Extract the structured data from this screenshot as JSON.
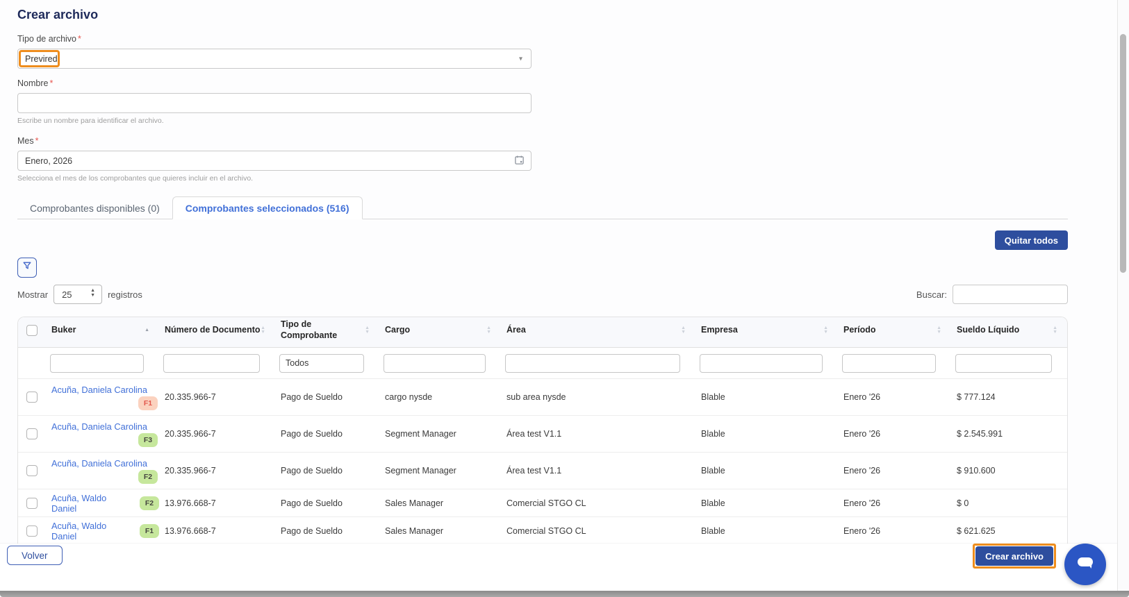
{
  "page": {
    "title": "Crear archivo"
  },
  "form": {
    "tipo": {
      "label": "Tipo de archivo",
      "required_mark": "*",
      "value": "Previred"
    },
    "nombre": {
      "label": "Nombre",
      "required_mark": "*",
      "value": "",
      "helper": "Escribe un nombre para identificar el archivo."
    },
    "mes": {
      "label": "Mes",
      "required_mark": "*",
      "value": "Enero, 2026",
      "helper": "Selecciona el mes de los comprobantes que quieres incluir en el archivo."
    }
  },
  "tabs": [
    {
      "label": "Comprobantes disponibles (0)",
      "active": false
    },
    {
      "label": "Comprobantes seleccionados (516)",
      "active": true
    }
  ],
  "toolbar": {
    "remove_all_label": "Quitar todos",
    "show_label": "Mostrar",
    "page_size": "25",
    "records_label": "registros",
    "search_label": "Buscar:"
  },
  "table": {
    "sort": {
      "column": "Buker",
      "direction": "asc"
    },
    "columns": [
      {
        "label": "Buker"
      },
      {
        "label": "Número de Documento"
      },
      {
        "label": "Tipo de Comprobante"
      },
      {
        "label": "Cargo"
      },
      {
        "label": "Área"
      },
      {
        "label": "Empresa"
      },
      {
        "label": "Período"
      },
      {
        "label": "Sueldo Líquido"
      }
    ],
    "filter_row": {
      "tipo_value": "Todos"
    },
    "rows": [
      {
        "name": "Acuña, Daniela Carolina",
        "badge": "F1",
        "badge_style": "salmon",
        "doc": "20.335.966-7",
        "tipo": "Pago de Sueldo",
        "cargo": "cargo nysde",
        "area": "sub area nysde",
        "empresa": "Blable",
        "periodo": "Enero '26",
        "sueldo": "$ 777.124"
      },
      {
        "name": "Acuña, Daniela Carolina",
        "badge": "F3",
        "badge_style": "green",
        "doc": "20.335.966-7",
        "tipo": "Pago de Sueldo",
        "cargo": "Segment Manager",
        "area": "Área test V1.1",
        "empresa": "Blable",
        "periodo": "Enero '26",
        "sueldo": "$ 2.545.991"
      },
      {
        "name": "Acuña, Daniela Carolina",
        "badge": "F2",
        "badge_style": "green",
        "doc": "20.335.966-7",
        "tipo": "Pago de Sueldo",
        "cargo": "Segment Manager",
        "area": "Área test V1.1",
        "empresa": "Blable",
        "periodo": "Enero '26",
        "sueldo": "$ 910.600"
      },
      {
        "name": "Acuña, Waldo Daniel",
        "badge": "F2",
        "badge_style": "green",
        "doc": "13.976.668-7",
        "tipo": "Pago de Sueldo",
        "cargo": "Sales Manager",
        "area": "Comercial STGO CL",
        "empresa": "Blable",
        "periodo": "Enero '26",
        "sueldo": "$ 0"
      },
      {
        "name": "Acuña, Waldo Daniel",
        "badge": "F1",
        "badge_style": "green",
        "doc": "13.976.668-7",
        "tipo": "Pago de Sueldo",
        "cargo": "Sales Manager",
        "area": "Comercial STGO CL",
        "empresa": "Blable",
        "periodo": "Enero '26",
        "sueldo": "$ 621.625"
      }
    ]
  },
  "footer": {
    "back_label": "Volver",
    "submit_label": "Crear archivo"
  },
  "colors": {
    "title_navy": "#1e2a5a",
    "primary_blue": "#2e4e9e",
    "link_blue": "#4170d8",
    "accent_orange": "#ee8d1d",
    "badge_salmon_bg": "#fbd2bf",
    "badge_salmon_text": "#e2574d",
    "badge_green_bg": "#c6e79c",
    "badge_green_text": "#45453f",
    "fab_blue": "#2b56c4"
  }
}
